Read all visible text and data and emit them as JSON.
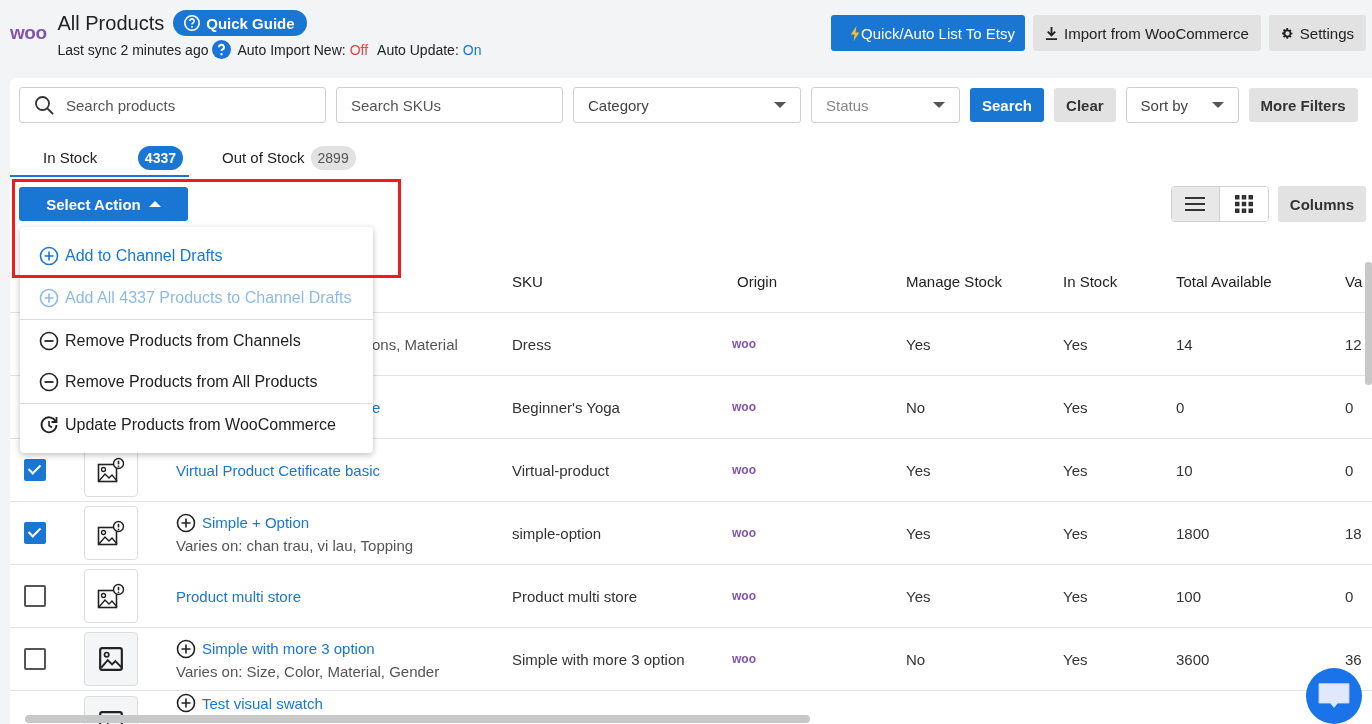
{
  "header": {
    "logo": "woo",
    "title": "All Products",
    "guide_button": "Quick Guide",
    "sync_text": "Last sync 2 minutes ago",
    "toggles": [
      {
        "label": "Auto Import New:",
        "value": "Off",
        "on": false
      },
      {
        "label": "Auto Update:",
        "value": "On",
        "on": true
      }
    ],
    "buttons": [
      {
        "kind": "primary",
        "label": "Quick/Auto List To Etsy"
      },
      {
        "kind": "secondary",
        "label": "Import from WooCommerce"
      },
      {
        "kind": "secondary",
        "label": "Settings"
      }
    ]
  },
  "filters": {
    "search": {
      "placeholder": "Search products"
    },
    "sku": {
      "placeholder": "Search SKUs"
    },
    "category": {
      "placeholder": "Category"
    },
    "status": {
      "placeholder": "Status"
    },
    "search_button": "Search",
    "clear_button": "Clear",
    "sort": {
      "placeholder": "Sort by"
    },
    "more_button": "More Filters"
  },
  "tabs": [
    {
      "label": "In Stock",
      "count": "4337",
      "selected": true
    },
    {
      "label": "Out of Stock",
      "count": "2899",
      "selected": false
    }
  ],
  "action_button": "Select Action",
  "action_menu": [
    {
      "kind": "add",
      "label": "Add to Channel Drafts",
      "disabled": false,
      "divider_before": false
    },
    {
      "kind": "add",
      "label": "Add All 4337 Products to Channel Drafts",
      "disabled": true,
      "divider_before": false
    },
    {
      "kind": "remove",
      "label": "Remove Products from Channels",
      "disabled": false,
      "divider_before": true
    },
    {
      "kind": "remove",
      "label": "Remove Products from All Products",
      "disabled": false,
      "divider_before": false
    },
    {
      "kind": "update",
      "label": "Update Products from WooCommerce",
      "disabled": false,
      "divider_before": true
    }
  ],
  "view_modes": [
    {
      "kind": "list",
      "selected": true
    },
    {
      "kind": "grid",
      "selected": false
    }
  ],
  "columns_button": "Columns",
  "table": {
    "columns": [
      "SKU",
      "Origin",
      "Manage Stock",
      "In Stock",
      "Total Available",
      "Va"
    ],
    "rows": [
      {
        "clipped": true,
        "variant": "ons, Material",
        "sku": "Dress",
        "origin": "woo",
        "manage_stock": "Yes",
        "in_stock": "Yes",
        "total_available": "14",
        "column_9": "12"
      },
      {
        "clipped": true,
        "name": "e",
        "sku": "Beginner's Yoga",
        "origin": "woo",
        "manage_stock": "No",
        "in_stock": "Yes",
        "total_available": "0",
        "column_9": "0"
      },
      {
        "checked": true,
        "thumb_warning": true,
        "expandable": false,
        "name": "Virtual Product Cetificate basic",
        "sku": "Virtual-product",
        "origin": "woo",
        "manage_stock": "Yes",
        "in_stock": "Yes",
        "total_available": "10",
        "column_9": "0"
      },
      {
        "checked": true,
        "thumb_warning": true,
        "expandable": true,
        "name": "Simple + Option",
        "variant": "Varies on: chan trau, vi lau, Topping",
        "sku": "simple-option",
        "origin": "woo",
        "manage_stock": "Yes",
        "in_stock": "Yes",
        "total_available": "1800",
        "column_9": "18"
      },
      {
        "checked": false,
        "thumb_warning": true,
        "expandable": false,
        "name": "Product multi store",
        "sku": "Product multi store",
        "origin": "woo",
        "manage_stock": "Yes",
        "in_stock": "Yes",
        "total_available": "100",
        "column_9": "0"
      },
      {
        "checked": false,
        "thumb_warning": false,
        "expandable": true,
        "name": "Simple with more 3 option",
        "variant": "Varies on: Size, Color, Material, Gender",
        "sku": "Simple with more 3 option",
        "origin": "woo",
        "manage_stock": "No",
        "in_stock": "Yes",
        "total_available": "3600",
        "column_9": "36"
      },
      {
        "thumb_warning": false,
        "expandable": true,
        "name": "Test visual swatch"
      }
    ]
  }
}
